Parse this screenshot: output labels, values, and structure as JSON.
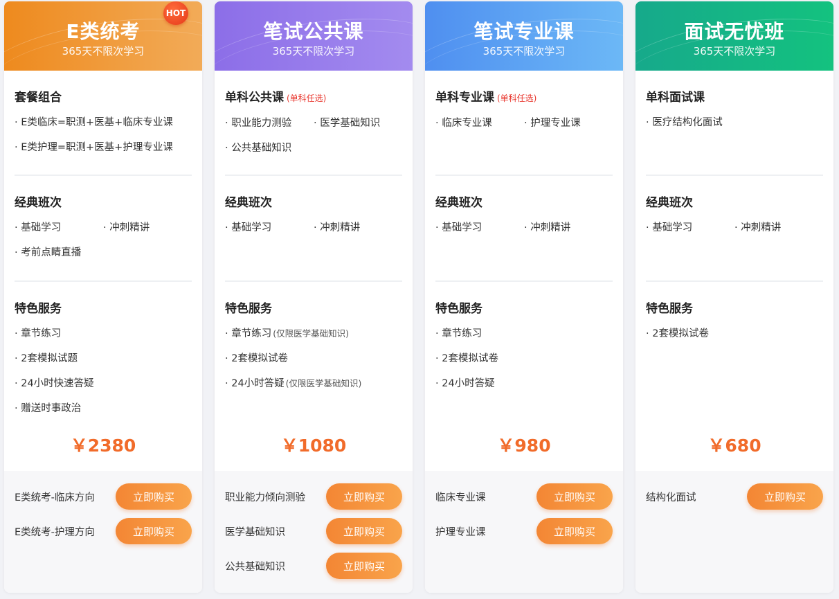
{
  "accent_color": "#f16b2a",
  "cards": [
    {
      "title": "E类统考",
      "subtitle": "365天不限次学习",
      "badge": "HOT",
      "section1": {
        "title": "套餐组合",
        "note": "",
        "items": [
          "· E类临床=职测+医基+临床专业课",
          "· E类护理=职测+医基+护理专业课"
        ]
      },
      "section2": {
        "title": "经典班次",
        "items": [
          "· 基础学习",
          "· 冲刺精讲",
          "· 考前点睛直播"
        ]
      },
      "section3": {
        "title": "特色服务",
        "items": [
          {
            "text": "· 章节练习",
            "note": ""
          },
          {
            "text": "· 2套模拟试题",
            "note": ""
          },
          {
            "text": "· 24小时快速答疑",
            "note": ""
          },
          {
            "text": "· 赠送时事政治",
            "note": ""
          }
        ]
      },
      "price": "￥2380",
      "buy_options": [
        {
          "label": "E类统考-临床方向",
          "button": "立即购买"
        },
        {
          "label": "E类统考-护理方向",
          "button": "立即购买"
        }
      ]
    },
    {
      "title": "笔试公共课",
      "subtitle": "365天不限次学习",
      "badge": "",
      "section1": {
        "title": "单科公共课",
        "note": "(单科任选)",
        "items": [
          "· 职业能力测验",
          "· 医学基础知识",
          "· 公共基础知识"
        ]
      },
      "section2": {
        "title": "经典班次",
        "items": [
          "· 基础学习",
          "· 冲刺精讲"
        ]
      },
      "section3": {
        "title": "特色服务",
        "items": [
          {
            "text": "· 章节练习",
            "note": "(仅限医学基础知识)"
          },
          {
            "text": "· 2套模拟试卷",
            "note": ""
          },
          {
            "text": "· 24小时答疑",
            "note": "(仅限医学基础知识)"
          }
        ]
      },
      "price": "￥1080",
      "buy_options": [
        {
          "label": "职业能力倾向测验",
          "button": "立即购买"
        },
        {
          "label": "医学基础知识",
          "button": "立即购买"
        },
        {
          "label": "公共基础知识",
          "button": "立即购买"
        }
      ]
    },
    {
      "title": "笔试专业课",
      "subtitle": "365天不限次学习",
      "badge": "",
      "section1": {
        "title": "单科专业课",
        "note": "(单科任选)",
        "items": [
          "· 临床专业课",
          "· 护理专业课"
        ]
      },
      "section2": {
        "title": "经典班次",
        "items": [
          "· 基础学习",
          "· 冲刺精讲"
        ]
      },
      "section3": {
        "title": "特色服务",
        "items": [
          {
            "text": "· 章节练习",
            "note": ""
          },
          {
            "text": "· 2套模拟试卷",
            "note": ""
          },
          {
            "text": "· 24小时答疑",
            "note": ""
          }
        ]
      },
      "price": "￥980",
      "buy_options": [
        {
          "label": "临床专业课",
          "button": "立即购买"
        },
        {
          "label": "护理专业课",
          "button": "立即购买"
        }
      ]
    },
    {
      "title": "面试无忧班",
      "subtitle": "365天不限次学习",
      "badge": "",
      "section1": {
        "title": "单科面试课",
        "note": "",
        "items": [
          "· 医疗结构化面试"
        ]
      },
      "section2": {
        "title": "经典班次",
        "items": [
          "· 基础学习",
          "· 冲刺精讲"
        ]
      },
      "section3": {
        "title": "特色服务",
        "items": [
          {
            "text": "· 2套模拟试卷",
            "note": ""
          }
        ]
      },
      "price": "￥680",
      "buy_options": [
        {
          "label": "结构化面试",
          "button": "立即购买"
        }
      ]
    }
  ]
}
